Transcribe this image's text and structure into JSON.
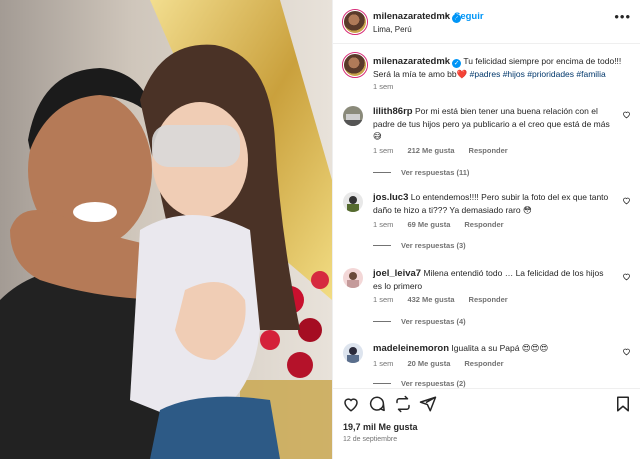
{
  "post_image": {
    "description_icon": "photo"
  },
  "header": {
    "username": "milenazaratedmk",
    "verified_icon": "verified-badge-icon",
    "separator": "•",
    "follow_label": "Seguir",
    "location": "Lima, Perú",
    "more_icon": "more-options-icon"
  },
  "caption": {
    "username": "milenazaratedmk",
    "text": "Tu felicidad siempre por encima de todo!!! Será la mía te amo bb",
    "emoji": "❤️",
    "hashtags": "#padres #hijos #prioridades #familia",
    "time": "1 sem"
  },
  "comments": [
    {
      "username": "lilith86rp",
      "text": "Por mi está bien tener una buena relación con el padre de tus hijos pero ya publicario a el creo que está de más 😅",
      "time": "1 sem",
      "likes": "212 Me gusta",
      "reply": "Responder",
      "view_replies": "Ver respuestas (11)"
    },
    {
      "username": "jos.luc3",
      "text": "Lo entendemos!!!! Pero subir la foto del ex que tanto daño te hizo a ti??? Ya demasiado raro 😳",
      "time": "1 sem",
      "likes": "69 Me gusta",
      "reply": "Responder",
      "view_replies": "Ver respuestas (3)"
    },
    {
      "username": "joel_leiva7",
      "text": "Milena entendió todo … La felicidad de los hijos es lo primero",
      "time": "1 sem",
      "likes": "432 Me gusta",
      "reply": "Responder",
      "view_replies": "Ver respuestas (4)"
    },
    {
      "username": "madeleinemoron",
      "text": "Igualita a su Papá 😍😍😍",
      "time": "1 sem",
      "likes": "20 Me gusta",
      "reply": "Responder",
      "view_replies": "Ver respuestas (2)"
    }
  ],
  "actions": {
    "like_icon": "heart-icon",
    "comment_icon": "comment-icon",
    "share_icon": "share-icon",
    "save_icon": "bookmark-icon",
    "likes": "19,7 mil Me gusta",
    "date": "12 de septiembre"
  },
  "colors": {
    "accent": "#0095f6",
    "text": "#262626",
    "muted": "#737373",
    "hashtag": "#00376b"
  }
}
